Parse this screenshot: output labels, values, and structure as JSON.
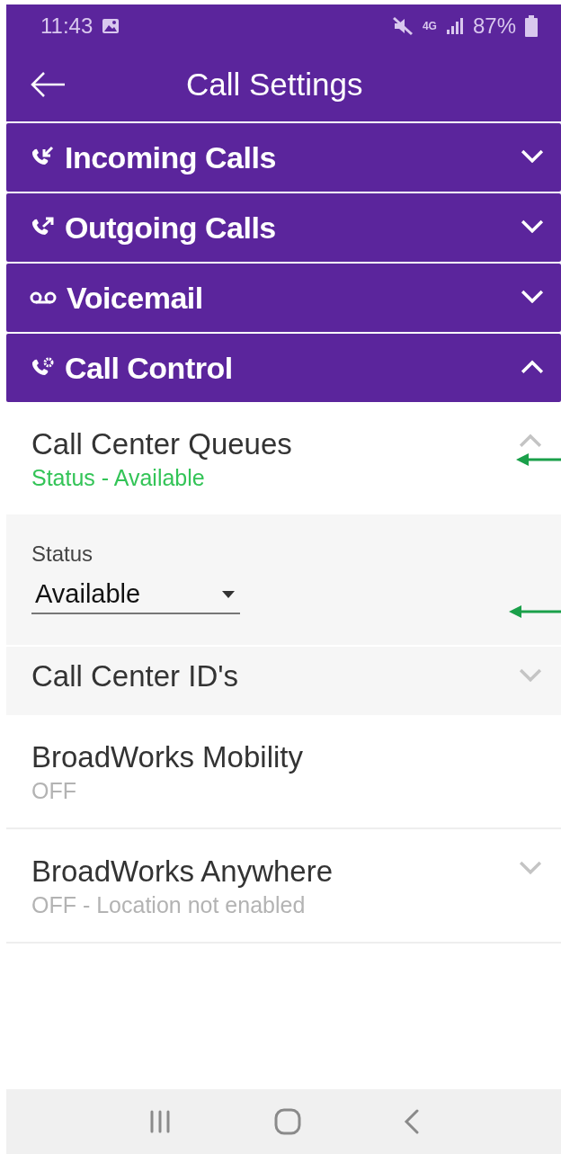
{
  "status_bar": {
    "time": "11:43",
    "network": "4G",
    "battery": "87%"
  },
  "app_bar": {
    "title": "Call Settings"
  },
  "sections": [
    {
      "label": "Incoming Calls",
      "kind": "incoming",
      "expanded": false
    },
    {
      "label": "Outgoing Calls",
      "kind": "outgoing",
      "expanded": false
    },
    {
      "label": "Voicemail",
      "kind": "voicemail",
      "expanded": false
    },
    {
      "label": "Call Control",
      "kind": "control",
      "expanded": true
    }
  ],
  "items": [
    {
      "kind": "setting",
      "title": "Call Center Queues",
      "subtitle": "Status - Available",
      "active": true,
      "expanded": true
    },
    {
      "kind": "dropdown",
      "label": "Status",
      "value": "Available"
    },
    {
      "kind": "sub_setting",
      "title": "Call Center ID's",
      "expanded": false
    },
    {
      "kind": "setting",
      "title": "BroadWorks Mobility",
      "subtitle": "OFF",
      "active": false
    },
    {
      "kind": "setting",
      "title": "BroadWorks Anywhere",
      "subtitle": "OFF - Location not enabled",
      "active": false,
      "expanded": false
    }
  ]
}
